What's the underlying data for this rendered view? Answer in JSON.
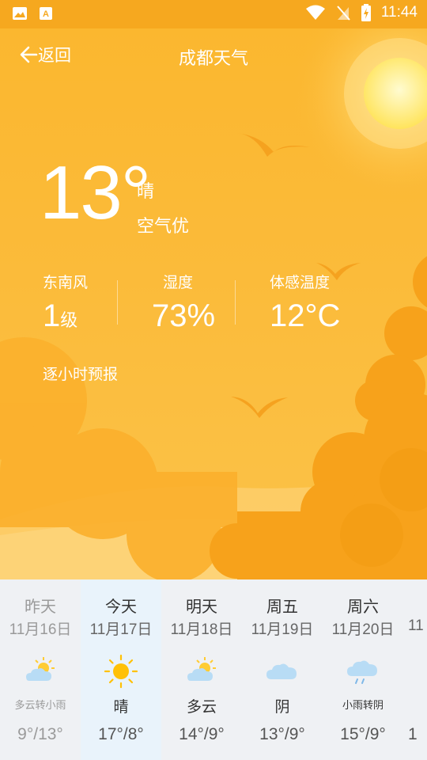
{
  "status_bar": {
    "time": "11:44"
  },
  "header": {
    "back_label": "返回",
    "title": "成都天气"
  },
  "current": {
    "temperature": "13°",
    "condition": "晴",
    "air_quality": "空气优",
    "wind": {
      "label": "东南风",
      "value": "1",
      "unit": "级"
    },
    "humidity": {
      "label": "湿度",
      "value": "73%"
    },
    "feels_like": {
      "label": "体感温度",
      "value": "12°C"
    }
  },
  "hourly_link": "逐小时预报",
  "forecast": [
    {
      "day": "昨天",
      "date": "11月16日",
      "icon": "partly-cloudy-icon",
      "condition": "多云转小雨",
      "temps": "9°/13°"
    },
    {
      "day": "今天",
      "date": "11月17日",
      "icon": "sun-icon",
      "condition": "晴",
      "temps": "17°/8°"
    },
    {
      "day": "明天",
      "date": "11月18日",
      "icon": "partly-cloudy-icon",
      "condition": "多云",
      "temps": "14°/9°"
    },
    {
      "day": "周五",
      "date": "11月19日",
      "icon": "cloud-icon",
      "condition": "阴",
      "temps": "13°/9°"
    },
    {
      "day": "周六",
      "date": "11月20日",
      "icon": "rain-cloud-icon",
      "condition": "小雨转阴",
      "temps": "15°/9°"
    },
    {
      "day": "",
      "date": "11",
      "icon": "",
      "condition": "",
      "temps": "1"
    }
  ],
  "colors": {
    "hero": "#fbb72f",
    "sun": "#fff176",
    "cloud": "#f7a21b",
    "forecast_bg": "#eff1f4",
    "today_bg": "#e9f3fb"
  }
}
